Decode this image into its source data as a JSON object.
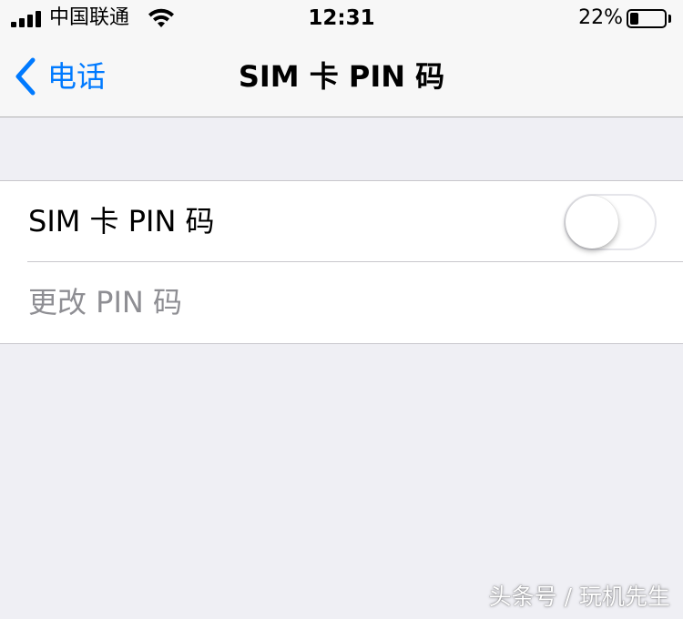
{
  "status_bar": {
    "carrier": "中国联通",
    "time": "12:31",
    "battery_percent": "22%",
    "battery_level": 0.22,
    "icons": [
      "signal-icon",
      "wifi-icon",
      "battery-icon"
    ]
  },
  "nav": {
    "back_label": "电话",
    "title": "SIM 卡 PIN 码"
  },
  "settings": {
    "rows": [
      {
        "label": "SIM 卡 PIN 码",
        "toggle_on": false
      },
      {
        "label": "更改 PIN 码",
        "disabled": true
      }
    ]
  },
  "watermark": "头条号 / 玩机先生",
  "colors": {
    "accent": "#007aff",
    "background": "#efeff4",
    "disabled_text": "#8e8e93"
  }
}
